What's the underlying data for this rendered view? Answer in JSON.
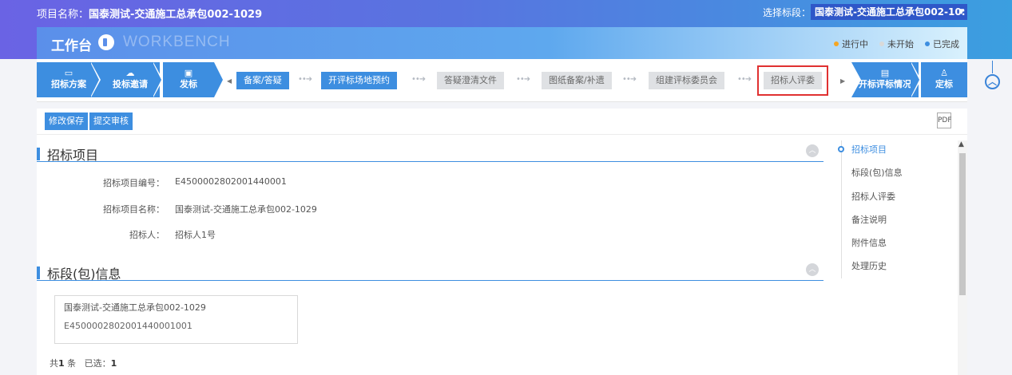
{
  "header": {
    "project_label": "项目名称：",
    "project_name": "国泰测试-交通施工总承包002-1029",
    "section_label": "选择标段：",
    "section_value": "国泰测试-交通施工总承包002-10:",
    "title": "工作台",
    "subtitle": "WORKBENCH",
    "legend": [
      {
        "label": "进行中",
        "color": "#f5a623"
      },
      {
        "label": "未开始",
        "color": "#d9d9d9"
      },
      {
        "label": "已完成",
        "color": "#3d8ee0"
      }
    ]
  },
  "steps": {
    "left": [
      {
        "label": "招标方案",
        "icon": "monitor-icon"
      },
      {
        "label": "投标邀请",
        "icon": "cloud-icon"
      },
      {
        "label": "发标",
        "icon": "briefcase-icon"
      }
    ],
    "middle": [
      {
        "label": "备案/答疑",
        "state": "active"
      },
      {
        "label": "开评标场地预约",
        "state": "active"
      },
      {
        "label": "答疑澄清文件",
        "state": "inactive"
      },
      {
        "label": "图纸备案/补遗",
        "state": "inactive"
      },
      {
        "label": "组建评标委员会",
        "state": "inactive"
      },
      {
        "label": "招标人评委",
        "state": "inactive"
      }
    ],
    "right": [
      {
        "label": "开标评标情况",
        "icon": "document-icon"
      },
      {
        "label": "定标",
        "icon": "user-icon"
      }
    ]
  },
  "toolbar": {
    "save": "修改保存",
    "submit": "提交审核",
    "pdf": "PDF"
  },
  "section1": {
    "title": "招标项目",
    "fields": [
      {
        "label": "招标项目编号：",
        "value": "E4500002802001440001"
      },
      {
        "label": "招标项目名称：",
        "value": "国泰测试-交通施工总承包002-1029"
      },
      {
        "label": "招标人：",
        "value": "招标人1号"
      }
    ]
  },
  "section2": {
    "title": "标段(包)信息",
    "card_name": "国泰测试-交通施工总承包002-1029",
    "card_code": "E4500002802001440001001",
    "count_prefix": "共",
    "count_total": "1",
    "count_unit": "条",
    "selected_label": "已选：",
    "selected_value": "1"
  },
  "side_nav": [
    {
      "label": "招标项目",
      "active": true
    },
    {
      "label": "标段(包)信息",
      "active": false
    },
    {
      "label": "招标人评委",
      "active": false
    },
    {
      "label": "备注说明",
      "active": false
    },
    {
      "label": "附件信息",
      "active": false
    },
    {
      "label": "处理历史",
      "active": false
    }
  ]
}
